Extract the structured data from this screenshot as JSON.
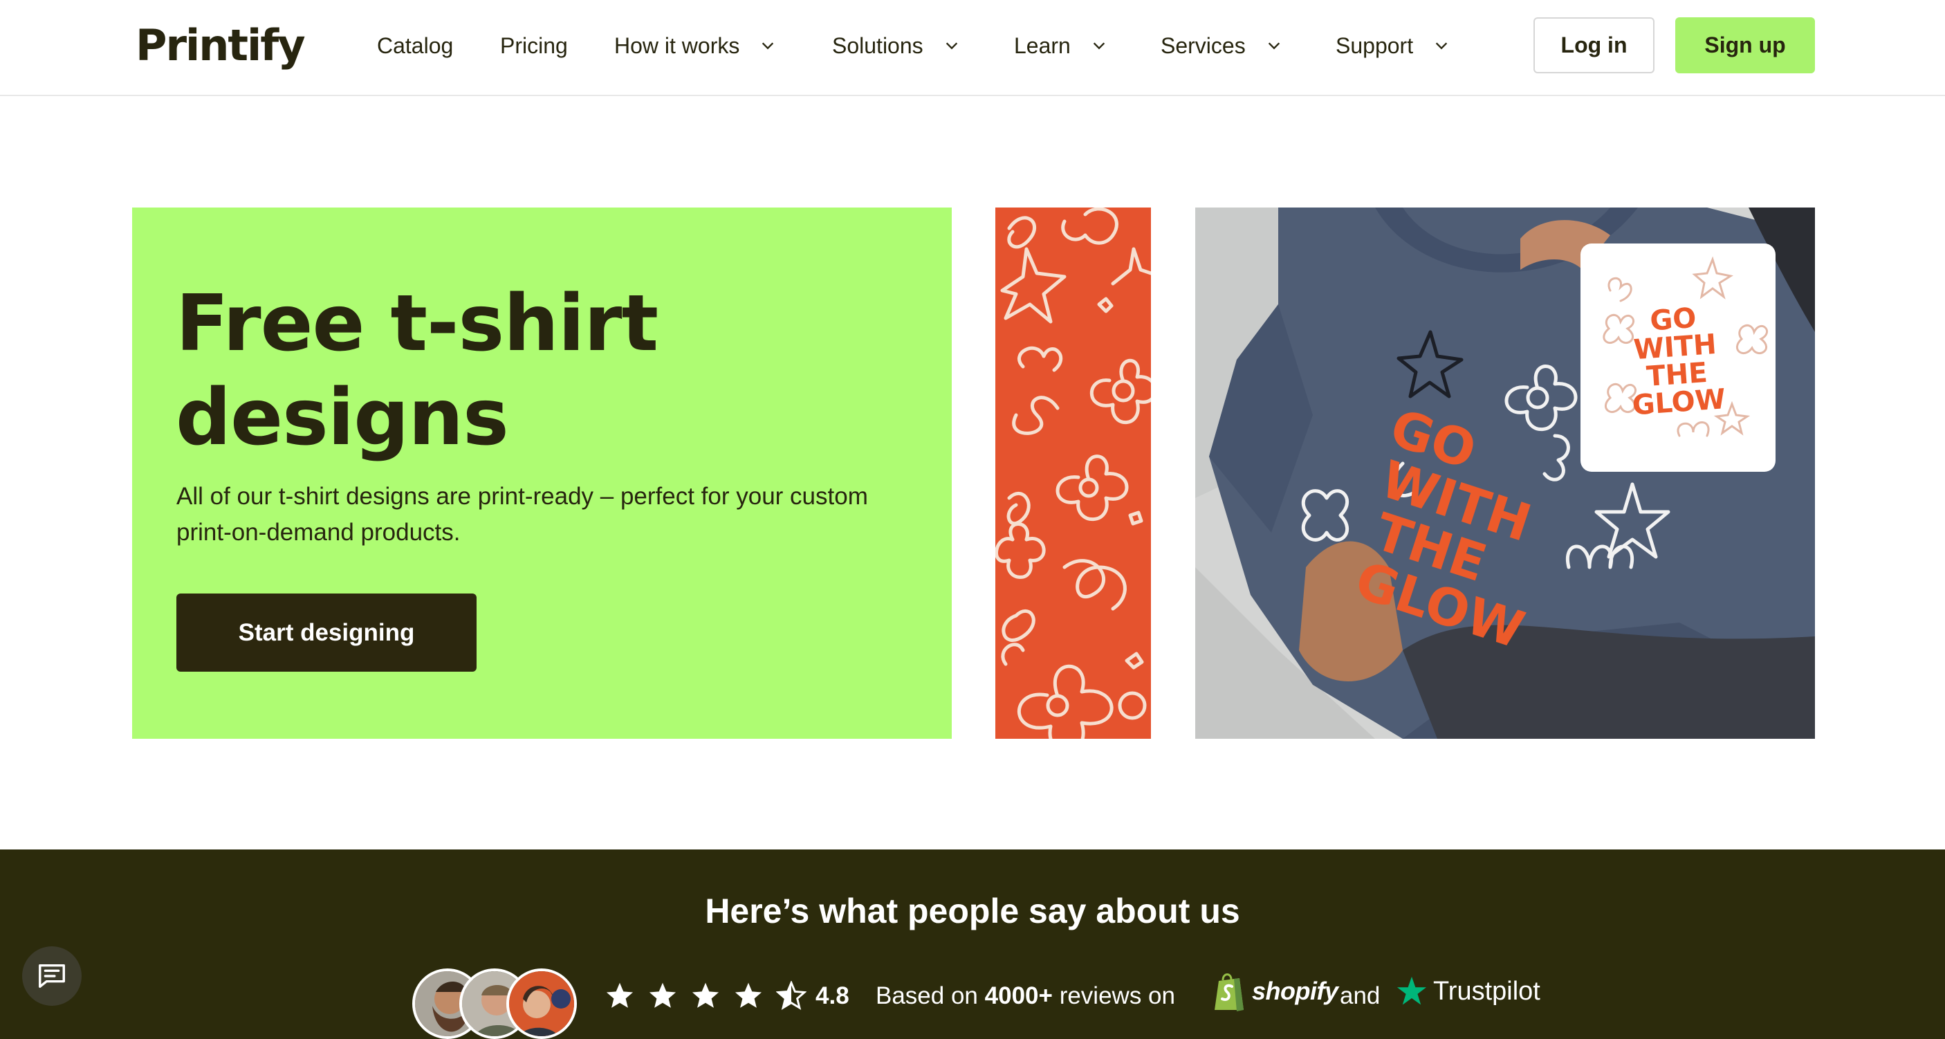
{
  "header": {
    "logo": "Printify",
    "nav": [
      {
        "label": "Catalog",
        "dropdown": false
      },
      {
        "label": "Pricing",
        "dropdown": false
      },
      {
        "label": "How it works",
        "dropdown": true
      },
      {
        "label": "Solutions",
        "dropdown": true
      },
      {
        "label": "Learn",
        "dropdown": true
      },
      {
        "label": "Services",
        "dropdown": true
      },
      {
        "label": "Support",
        "dropdown": true
      }
    ],
    "login_label": "Log in",
    "signup_label": "Sign up"
  },
  "hero": {
    "title_line1": "Free t-shirt",
    "title_line2": "designs",
    "description": "All of our t-shirt designs are print-ready – perfect for your custom print-on-demand products.",
    "cta_label": "Start designing",
    "photo_print_text": [
      "GO",
      "WITH",
      "THE",
      "GLOW"
    ],
    "photo_card_text": [
      "GO",
      "WITH",
      "THE",
      "GLOW"
    ]
  },
  "reviews": {
    "title": "Here’s what people say about us",
    "rating": "4.8",
    "stars": 4.5,
    "based_prefix": "Based on",
    "count": "4000+",
    "based_suffix": "reviews on",
    "shopify_label": "shopify",
    "and_label": "and",
    "trustpilot_label": "Trustpilot"
  },
  "colors": {
    "brand_dark": "#27250f",
    "accent_green": "#aefc72",
    "signup_green": "#a9f26c",
    "pattern_orange": "#e5532e",
    "band_dark": "#2c2b0c",
    "trustpilot_green": "#00b67a",
    "shopify_green": "#95bf47"
  },
  "icons": {
    "chevron": "chevron-down-icon",
    "chat": "chat-icon",
    "star": "star-icon"
  }
}
